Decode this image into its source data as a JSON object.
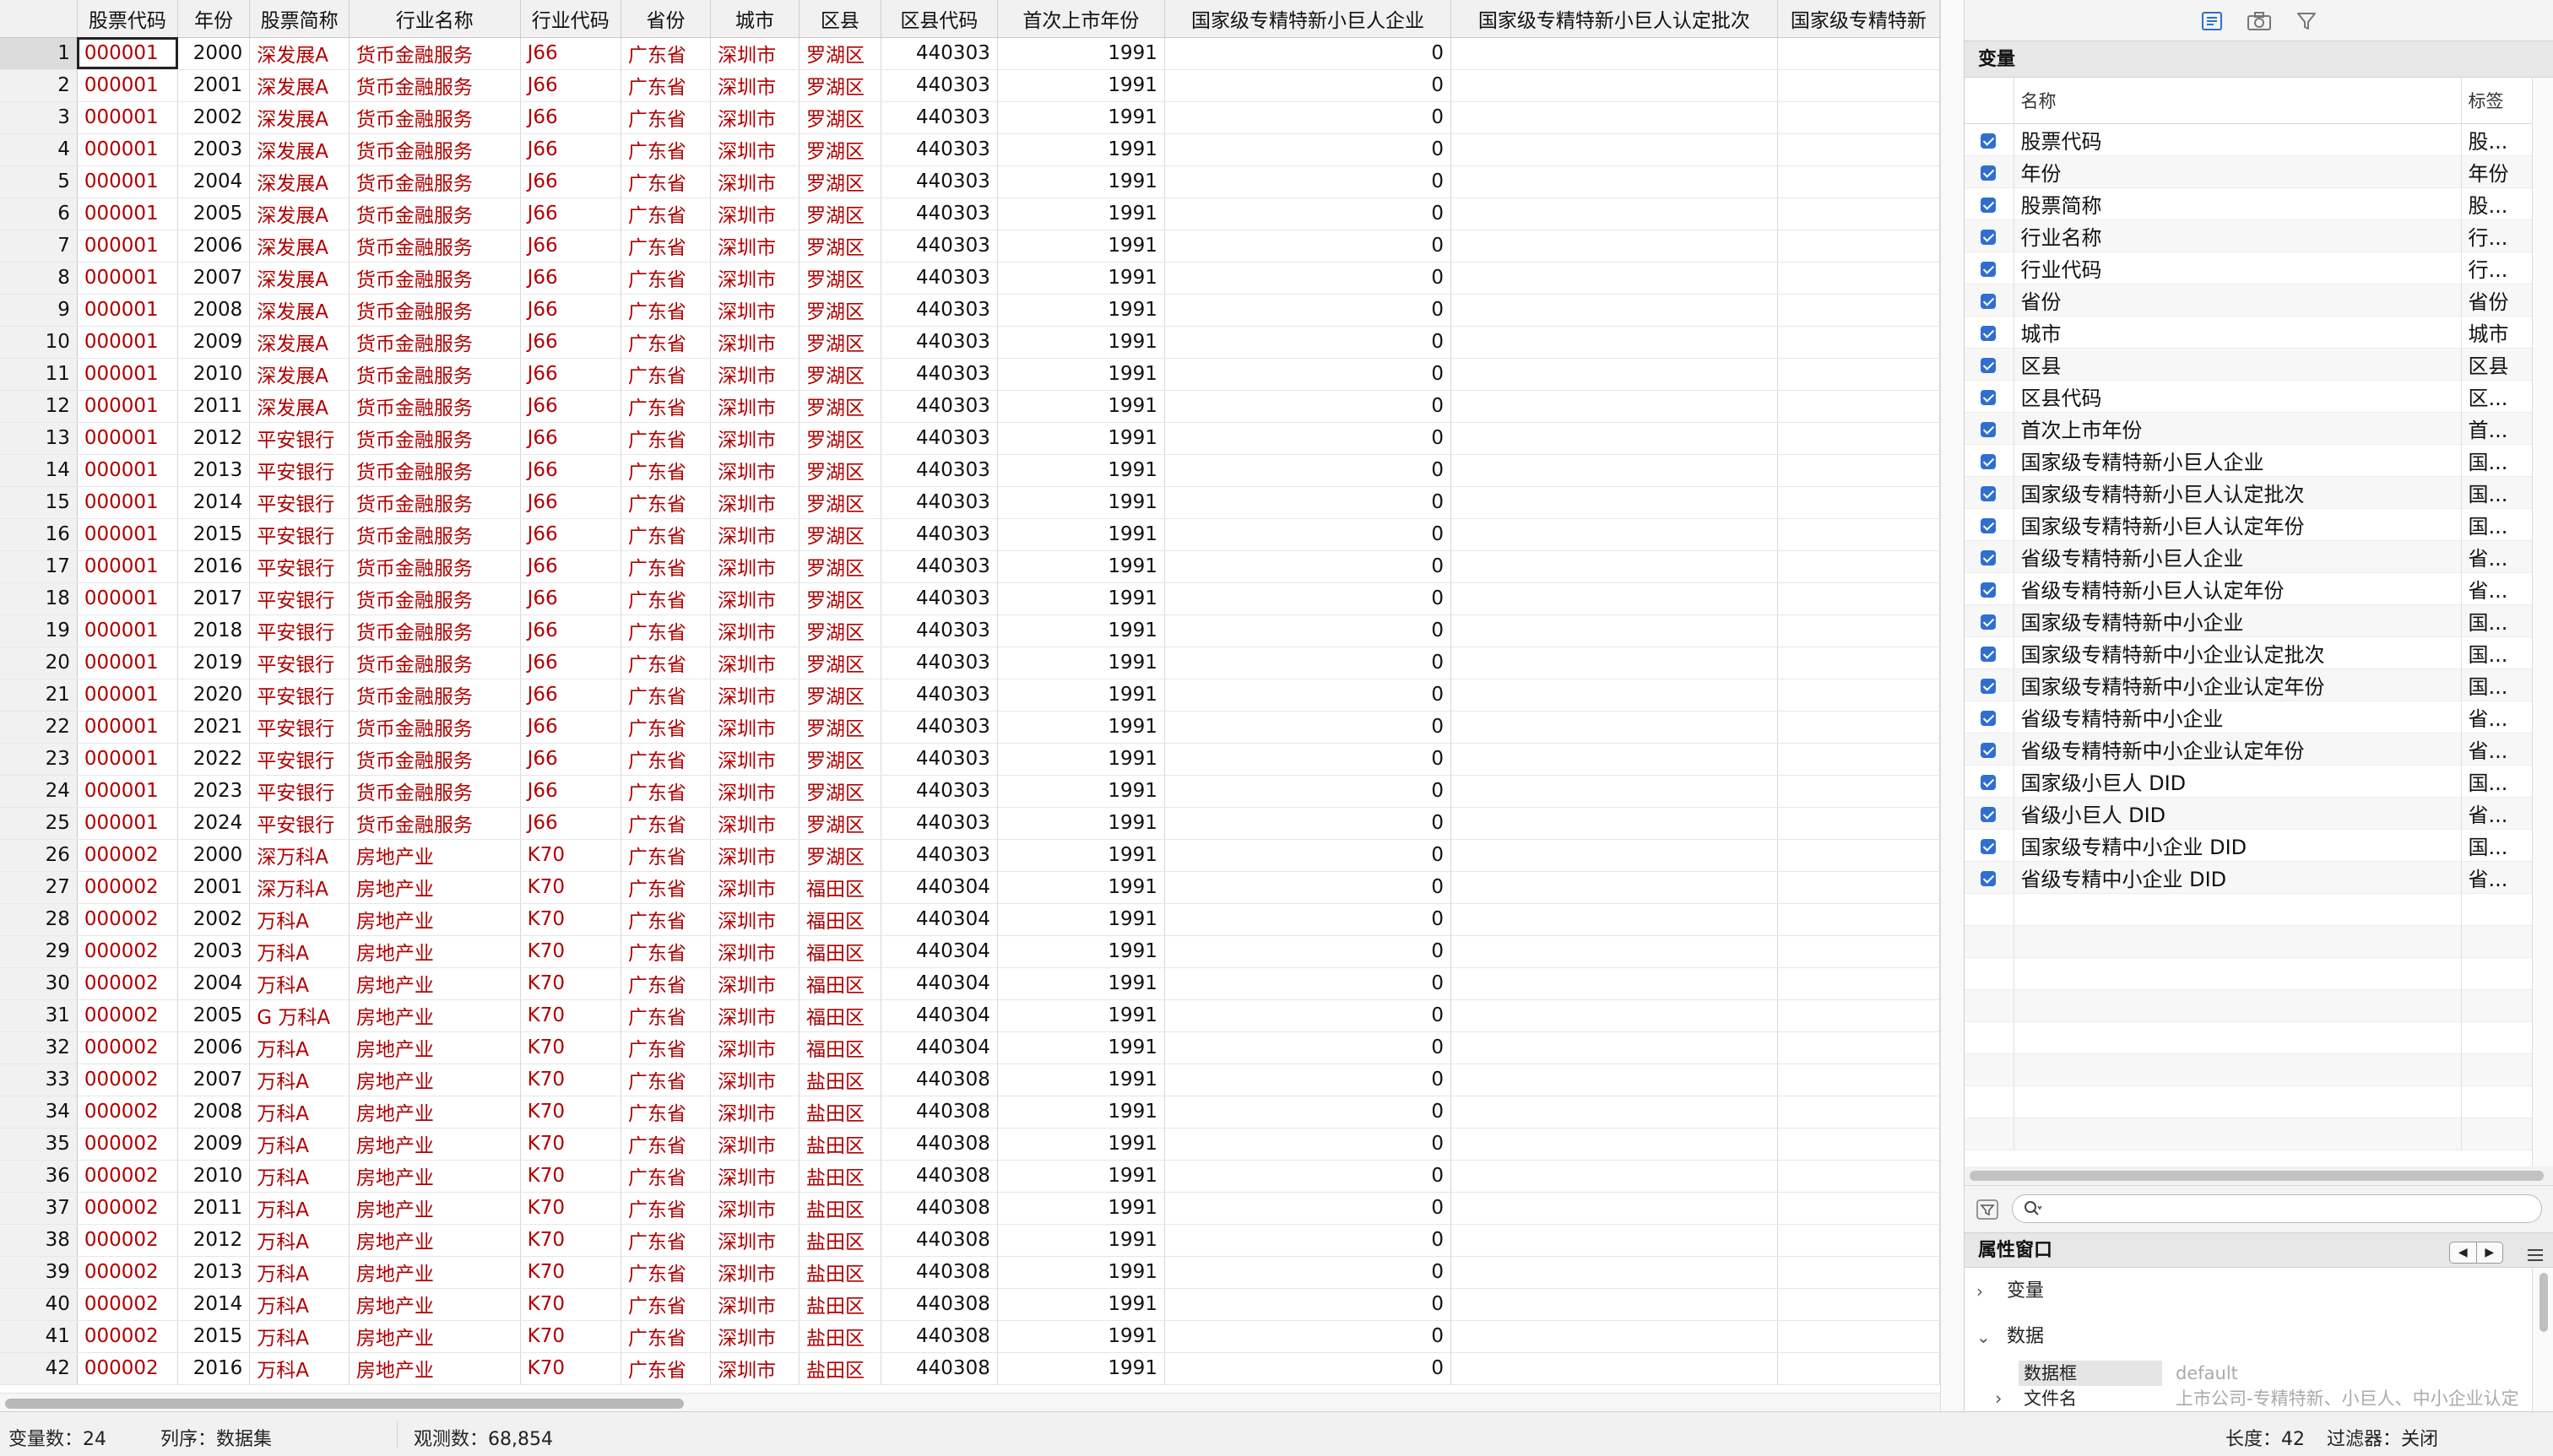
{
  "grid": {
    "columns": [
      {
        "label": "股票代码",
        "type": "str"
      },
      {
        "label": "年份",
        "type": "num"
      },
      {
        "label": "股票简称",
        "type": "str"
      },
      {
        "label": "行业名称",
        "type": "str"
      },
      {
        "label": "行业代码",
        "type": "str"
      },
      {
        "label": "省份",
        "type": "str"
      },
      {
        "label": "城市",
        "type": "str"
      },
      {
        "label": "区县",
        "type": "str"
      },
      {
        "label": "区县代码",
        "type": "num"
      },
      {
        "label": "首次上市年份",
        "type": "num"
      },
      {
        "label": "国家级专精特新小巨人企业",
        "type": "num"
      },
      {
        "label": "国家级专精特新小巨人认定批次",
        "type": "empty"
      },
      {
        "label": "国家级专精特新",
        "type": "empty"
      }
    ],
    "rows": [
      [
        "000001",
        "2000",
        "深发展A",
        "货币金融服务",
        "J66",
        "广东省",
        "深圳市",
        "罗湖区",
        "440303",
        "1991",
        "0",
        "",
        ""
      ],
      [
        "000001",
        "2001",
        "深发展A",
        "货币金融服务",
        "J66",
        "广东省",
        "深圳市",
        "罗湖区",
        "440303",
        "1991",
        "0",
        "",
        ""
      ],
      [
        "000001",
        "2002",
        "深发展A",
        "货币金融服务",
        "J66",
        "广东省",
        "深圳市",
        "罗湖区",
        "440303",
        "1991",
        "0",
        "",
        ""
      ],
      [
        "000001",
        "2003",
        "深发展A",
        "货币金融服务",
        "J66",
        "广东省",
        "深圳市",
        "罗湖区",
        "440303",
        "1991",
        "0",
        "",
        ""
      ],
      [
        "000001",
        "2004",
        "深发展A",
        "货币金融服务",
        "J66",
        "广东省",
        "深圳市",
        "罗湖区",
        "440303",
        "1991",
        "0",
        "",
        ""
      ],
      [
        "000001",
        "2005",
        "深发展A",
        "货币金融服务",
        "J66",
        "广东省",
        "深圳市",
        "罗湖区",
        "440303",
        "1991",
        "0",
        "",
        ""
      ],
      [
        "000001",
        "2006",
        "深发展A",
        "货币金融服务",
        "J66",
        "广东省",
        "深圳市",
        "罗湖区",
        "440303",
        "1991",
        "0",
        "",
        ""
      ],
      [
        "000001",
        "2007",
        "深发展A",
        "货币金融服务",
        "J66",
        "广东省",
        "深圳市",
        "罗湖区",
        "440303",
        "1991",
        "0",
        "",
        ""
      ],
      [
        "000001",
        "2008",
        "深发展A",
        "货币金融服务",
        "J66",
        "广东省",
        "深圳市",
        "罗湖区",
        "440303",
        "1991",
        "0",
        "",
        ""
      ],
      [
        "000001",
        "2009",
        "深发展A",
        "货币金融服务",
        "J66",
        "广东省",
        "深圳市",
        "罗湖区",
        "440303",
        "1991",
        "0",
        "",
        ""
      ],
      [
        "000001",
        "2010",
        "深发展A",
        "货币金融服务",
        "J66",
        "广东省",
        "深圳市",
        "罗湖区",
        "440303",
        "1991",
        "0",
        "",
        ""
      ],
      [
        "000001",
        "2011",
        "深发展A",
        "货币金融服务",
        "J66",
        "广东省",
        "深圳市",
        "罗湖区",
        "440303",
        "1991",
        "0",
        "",
        ""
      ],
      [
        "000001",
        "2012",
        "平安银行",
        "货币金融服务",
        "J66",
        "广东省",
        "深圳市",
        "罗湖区",
        "440303",
        "1991",
        "0",
        "",
        ""
      ],
      [
        "000001",
        "2013",
        "平安银行",
        "货币金融服务",
        "J66",
        "广东省",
        "深圳市",
        "罗湖区",
        "440303",
        "1991",
        "0",
        "",
        ""
      ],
      [
        "000001",
        "2014",
        "平安银行",
        "货币金融服务",
        "J66",
        "广东省",
        "深圳市",
        "罗湖区",
        "440303",
        "1991",
        "0",
        "",
        ""
      ],
      [
        "000001",
        "2015",
        "平安银行",
        "货币金融服务",
        "J66",
        "广东省",
        "深圳市",
        "罗湖区",
        "440303",
        "1991",
        "0",
        "",
        ""
      ],
      [
        "000001",
        "2016",
        "平安银行",
        "货币金融服务",
        "J66",
        "广东省",
        "深圳市",
        "罗湖区",
        "440303",
        "1991",
        "0",
        "",
        ""
      ],
      [
        "000001",
        "2017",
        "平安银行",
        "货币金融服务",
        "J66",
        "广东省",
        "深圳市",
        "罗湖区",
        "440303",
        "1991",
        "0",
        "",
        ""
      ],
      [
        "000001",
        "2018",
        "平安银行",
        "货币金融服务",
        "J66",
        "广东省",
        "深圳市",
        "罗湖区",
        "440303",
        "1991",
        "0",
        "",
        ""
      ],
      [
        "000001",
        "2019",
        "平安银行",
        "货币金融服务",
        "J66",
        "广东省",
        "深圳市",
        "罗湖区",
        "440303",
        "1991",
        "0",
        "",
        ""
      ],
      [
        "000001",
        "2020",
        "平安银行",
        "货币金融服务",
        "J66",
        "广东省",
        "深圳市",
        "罗湖区",
        "440303",
        "1991",
        "0",
        "",
        ""
      ],
      [
        "000001",
        "2021",
        "平安银行",
        "货币金融服务",
        "J66",
        "广东省",
        "深圳市",
        "罗湖区",
        "440303",
        "1991",
        "0",
        "",
        ""
      ],
      [
        "000001",
        "2022",
        "平安银行",
        "货币金融服务",
        "J66",
        "广东省",
        "深圳市",
        "罗湖区",
        "440303",
        "1991",
        "0",
        "",
        ""
      ],
      [
        "000001",
        "2023",
        "平安银行",
        "货币金融服务",
        "J66",
        "广东省",
        "深圳市",
        "罗湖区",
        "440303",
        "1991",
        "0",
        "",
        ""
      ],
      [
        "000001",
        "2024",
        "平安银行",
        "货币金融服务",
        "J66",
        "广东省",
        "深圳市",
        "罗湖区",
        "440303",
        "1991",
        "0",
        "",
        ""
      ],
      [
        "000002",
        "2000",
        "深万科A",
        "房地产业",
        "K70",
        "广东省",
        "深圳市",
        "罗湖区",
        "440303",
        "1991",
        "0",
        "",
        ""
      ],
      [
        "000002",
        "2001",
        "深万科A",
        "房地产业",
        "K70",
        "广东省",
        "深圳市",
        "福田区",
        "440304",
        "1991",
        "0",
        "",
        ""
      ],
      [
        "000002",
        "2002",
        "万科A",
        "房地产业",
        "K70",
        "广东省",
        "深圳市",
        "福田区",
        "440304",
        "1991",
        "0",
        "",
        ""
      ],
      [
        "000002",
        "2003",
        "万科A",
        "房地产业",
        "K70",
        "广东省",
        "深圳市",
        "福田区",
        "440304",
        "1991",
        "0",
        "",
        ""
      ],
      [
        "000002",
        "2004",
        "万科A",
        "房地产业",
        "K70",
        "广东省",
        "深圳市",
        "福田区",
        "440304",
        "1991",
        "0",
        "",
        ""
      ],
      [
        "000002",
        "2005",
        "G 万科A",
        "房地产业",
        "K70",
        "广东省",
        "深圳市",
        "福田区",
        "440304",
        "1991",
        "0",
        "",
        ""
      ],
      [
        "000002",
        "2006",
        "万科A",
        "房地产业",
        "K70",
        "广东省",
        "深圳市",
        "福田区",
        "440304",
        "1991",
        "0",
        "",
        ""
      ],
      [
        "000002",
        "2007",
        "万科A",
        "房地产业",
        "K70",
        "广东省",
        "深圳市",
        "盐田区",
        "440308",
        "1991",
        "0",
        "",
        ""
      ],
      [
        "000002",
        "2008",
        "万科A",
        "房地产业",
        "K70",
        "广东省",
        "深圳市",
        "盐田区",
        "440308",
        "1991",
        "0",
        "",
        ""
      ],
      [
        "000002",
        "2009",
        "万科A",
        "房地产业",
        "K70",
        "广东省",
        "深圳市",
        "盐田区",
        "440308",
        "1991",
        "0",
        "",
        ""
      ],
      [
        "000002",
        "2010",
        "万科A",
        "房地产业",
        "K70",
        "广东省",
        "深圳市",
        "盐田区",
        "440308",
        "1991",
        "0",
        "",
        ""
      ],
      [
        "000002",
        "2011",
        "万科A",
        "房地产业",
        "K70",
        "广东省",
        "深圳市",
        "盐田区",
        "440308",
        "1991",
        "0",
        "",
        ""
      ],
      [
        "000002",
        "2012",
        "万科A",
        "房地产业",
        "K70",
        "广东省",
        "深圳市",
        "盐田区",
        "440308",
        "1991",
        "0",
        "",
        ""
      ],
      [
        "000002",
        "2013",
        "万科A",
        "房地产业",
        "K70",
        "广东省",
        "深圳市",
        "盐田区",
        "440308",
        "1991",
        "0",
        "",
        ""
      ],
      [
        "000002",
        "2014",
        "万科A",
        "房地产业",
        "K70",
        "广东省",
        "深圳市",
        "盐田区",
        "440308",
        "1991",
        "0",
        "",
        ""
      ],
      [
        "000002",
        "2015",
        "万科A",
        "房地产业",
        "K70",
        "广东省",
        "深圳市",
        "盐田区",
        "440308",
        "1991",
        "0",
        "",
        ""
      ],
      [
        "000002",
        "2016",
        "万科A",
        "房地产业",
        "K70",
        "广东省",
        "深圳市",
        "盐田区",
        "440308",
        "1991",
        "0",
        "",
        ""
      ]
    ]
  },
  "right_panel": {
    "toolbar_icons": [
      "variables-list-icon",
      "snapshot-camera-icon",
      "filter-icon"
    ],
    "variables_header": "变量",
    "var_columns": {
      "name": "名称",
      "label": "标签"
    },
    "variables": [
      {
        "name": "股票代码",
        "label": "股..."
      },
      {
        "name": "年份",
        "label": "年份"
      },
      {
        "name": "股票简称",
        "label": "股..."
      },
      {
        "name": "行业名称",
        "label": "行..."
      },
      {
        "name": "行业代码",
        "label": "行..."
      },
      {
        "name": "省份",
        "label": "省份"
      },
      {
        "name": "城市",
        "label": "城市"
      },
      {
        "name": "区县",
        "label": "区县"
      },
      {
        "name": "区县代码",
        "label": "区..."
      },
      {
        "name": "首次上市年份",
        "label": "首..."
      },
      {
        "name": "国家级专精特新小巨人企业",
        "label": "国..."
      },
      {
        "name": "国家级专精特新小巨人认定批次",
        "label": "国..."
      },
      {
        "name": "国家级专精特新小巨人认定年份",
        "label": "国..."
      },
      {
        "name": "省级专精特新小巨人企业",
        "label": "省..."
      },
      {
        "name": "省级专精特新小巨人认定年份",
        "label": "省..."
      },
      {
        "name": "国家级专精特新中小企业",
        "label": "国..."
      },
      {
        "name": "国家级专精特新中小企业认定批次",
        "label": "国..."
      },
      {
        "name": "国家级专精特新中小企业认定年份",
        "label": "国..."
      },
      {
        "name": "省级专精特新中小企业",
        "label": "省..."
      },
      {
        "name": "省级专精特新中小企业认定年份",
        "label": "省..."
      },
      {
        "name": "国家级小巨人 DID",
        "label": "国..."
      },
      {
        "name": "省级小巨人 DID",
        "label": "省..."
      },
      {
        "name": "国家级专精中小企业 DID",
        "label": "国..."
      },
      {
        "name": "省级专精中小企业 DID",
        "label": "省..."
      }
    ],
    "search_placeholder": "",
    "properties_header": "属性窗口",
    "prop_nav_prev": "◀",
    "prop_nav_next": "▶",
    "prop_sections": {
      "variable": "变量",
      "data": "数据"
    },
    "prop_rows": [
      {
        "key": "数据框",
        "value": "default"
      },
      {
        "key": "文件名",
        "value": "上市公司-专精特新、小巨人、中小企业认定"
      }
    ]
  },
  "statusbar": {
    "var_count": "变量数：24",
    "sort": "列序：数据集",
    "obs": "观测数：68,854",
    "length": "长度：42",
    "filter": "过滤器：关闭"
  },
  "colors": {
    "string_text": "#b00000",
    "checkbox": "#2e6fd0"
  }
}
